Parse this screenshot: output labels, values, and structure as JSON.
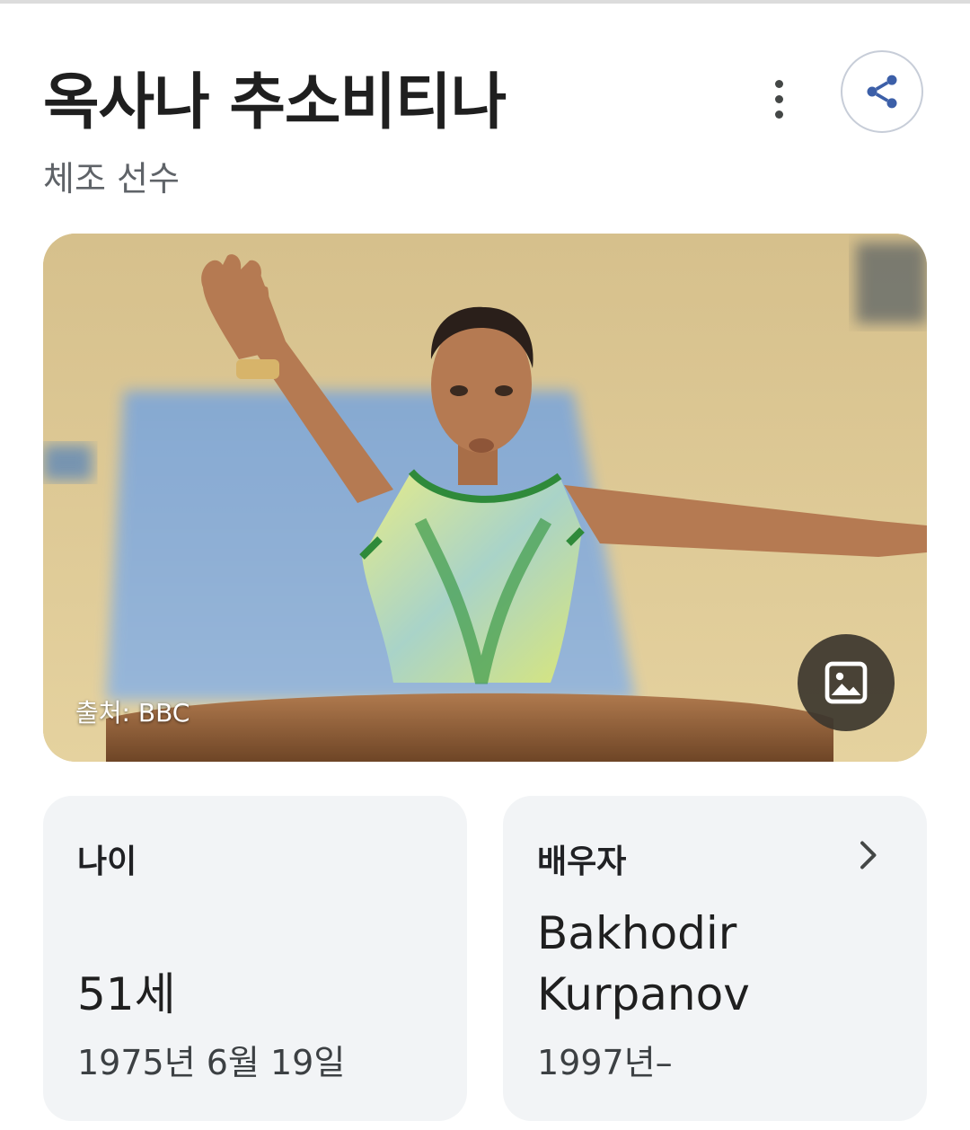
{
  "header": {
    "title": "옥사나 추소비티나",
    "subtitle": "체조 선수"
  },
  "icons": {
    "more": "more-vert-icon",
    "share": "share-icon",
    "gallery": "image-gallery-icon",
    "chevron": "chevron-right-icon"
  },
  "photo": {
    "credit": "출처: BBC"
  },
  "cards": {
    "age": {
      "label": "나이",
      "value": "51세",
      "sub": "1975년 6월 19일"
    },
    "spouse": {
      "label": "배우자",
      "name_line1": "Bakhodir",
      "name_line2": "Kurpanov",
      "sub": "1997년–"
    }
  },
  "colors": {
    "accent_blue": "#3c5fa8",
    "card_bg": "#f2f4f6",
    "title_text": "#1f1f1f"
  }
}
